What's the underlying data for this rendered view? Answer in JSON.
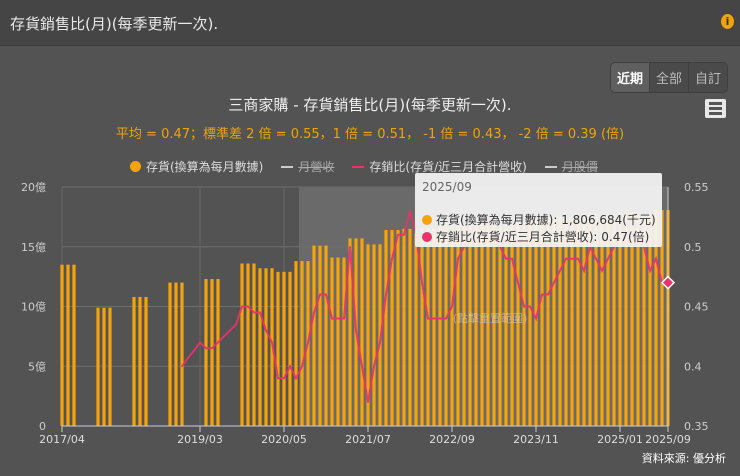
{
  "header": {
    "title": "存貨銷售比(月)(每季更新一次).",
    "info_icon": "info-icon"
  },
  "range_buttons": [
    "近期",
    "全部",
    "自訂"
  ],
  "chart_data": {
    "type": "bar+line",
    "title": "三商家購 - 存貨銷售比(月)(每季更新一次).",
    "subtitle": "平均 = 0.47；標準差 2 倍 = 0.55，1 倍 = 0.51， -1 倍 = 0.43， -2 倍 = 0.39 (倍)",
    "legend": [
      {
        "name": "存貨(換算為每月數據)",
        "color": "#f5a30b",
        "visible": true
      },
      {
        "name": "月營收",
        "color": "#cccccc",
        "visible": false
      },
      {
        "name": "存銷比(存貨/近三月合計營收)",
        "color": "#e8336b",
        "visible": true
      },
      {
        "name": "月股價",
        "color": "#cccccc",
        "visible": false
      }
    ],
    "start_month": "2017/04",
    "months": 102,
    "x_ticks": [
      {
        "i": 0,
        "label": "2017/04"
      },
      {
        "i": 23,
        "label": "2019/03"
      },
      {
        "i": 37,
        "label": "2020/05"
      },
      {
        "i": 51,
        "label": "2021/07"
      },
      {
        "i": 65,
        "label": "2022/09"
      },
      {
        "i": 79,
        "label": "2023/11"
      },
      {
        "i": 93,
        "label": "2025/01"
      },
      {
        "i": 101,
        "label": "2025/09"
      }
    ],
    "y_left": {
      "min": 0,
      "max": 20,
      "ticks": [
        "0",
        "5億",
        "10億",
        "15億",
        "20億"
      ],
      "unit": "億"
    },
    "y_right": {
      "min": 0.35,
      "max": 0.55,
      "ticks": [
        "0.35",
        "0.4",
        "0.45",
        "0.5",
        "0.55"
      ]
    },
    "highlight_band_start_index": 40,
    "inventory": [
      13.5,
      13.5,
      13.5,
      null,
      null,
      null,
      9.9,
      9.9,
      9.9,
      null,
      null,
      null,
      10.8,
      10.8,
      10.8,
      null,
      null,
      null,
      12.0,
      12.0,
      12.0,
      null,
      null,
      null,
      12.3,
      12.3,
      12.3,
      null,
      null,
      null,
      13.6,
      13.6,
      13.6,
      13.2,
      13.2,
      13.2,
      12.9,
      12.9,
      12.9,
      13.8,
      13.8,
      13.8,
      15.1,
      15.1,
      15.1,
      14.1,
      14.1,
      14.1,
      15.7,
      15.7,
      15.7,
      15.2,
      15.2,
      15.2,
      16.4,
      16.4,
      16.4,
      16.5,
      16.5,
      16.5,
      16.6,
      16.6,
      16.6,
      16.8,
      16.8,
      16.8,
      16.9,
      16.9,
      16.9,
      17.0,
      17.0,
      17.0,
      16.8,
      16.8,
      16.8,
      17.1,
      17.1,
      17.1,
      17.3,
      17.3,
      17.3,
      17.5,
      17.5,
      17.5,
      17.4,
      17.4,
      17.4,
      17.8,
      17.8,
      17.8,
      17.6,
      17.6,
      17.6,
      17.9,
      17.9,
      17.9,
      17.7,
      17.7,
      17.7,
      18.07,
      18.07,
      18.07
    ],
    "ratio": [
      null,
      null,
      null,
      null,
      null,
      null,
      null,
      null,
      null,
      null,
      null,
      null,
      null,
      null,
      null,
      null,
      null,
      null,
      null,
      null,
      0.4,
      0.407,
      0.413,
      0.42,
      0.415,
      0.415,
      0.42,
      0.425,
      0.43,
      0.435,
      0.45,
      0.45,
      0.445,
      0.445,
      0.43,
      0.42,
      0.39,
      0.39,
      0.4,
      0.39,
      0.4,
      0.42,
      0.445,
      0.46,
      0.46,
      0.44,
      0.44,
      0.44,
      0.5,
      0.43,
      0.4,
      0.37,
      0.4,
      0.42,
      0.46,
      0.49,
      0.51,
      0.51,
      0.53,
      0.51,
      0.47,
      0.44,
      0.44,
      0.44,
      0.44,
      0.45,
      0.49,
      0.5,
      0.51,
      0.52,
      0.53,
      0.52,
      0.51,
      0.5,
      0.49,
      0.49,
      0.47,
      0.45,
      0.45,
      0.44,
      0.46,
      0.46,
      0.47,
      0.48,
      0.49,
      0.49,
      0.49,
      0.48,
      0.5,
      0.49,
      0.48,
      0.49,
      0.5,
      0.51,
      0.52,
      0.51,
      0.51,
      0.5,
      0.48,
      0.49,
      0.47,
      0.47
    ],
    "reset_zoom_label": "(點擊重置範圍)"
  },
  "tooltip": {
    "date": "2025/09",
    "rows": [
      {
        "label": "存貨(換算為每月數據): 1,806,684(千元)",
        "color": "#f5a30b"
      },
      {
        "label": "存銷比(存貨/近三月合計營收): 0.47(倍)",
        "color": "#e8336b"
      }
    ]
  },
  "source": "資料來源: 優分析"
}
